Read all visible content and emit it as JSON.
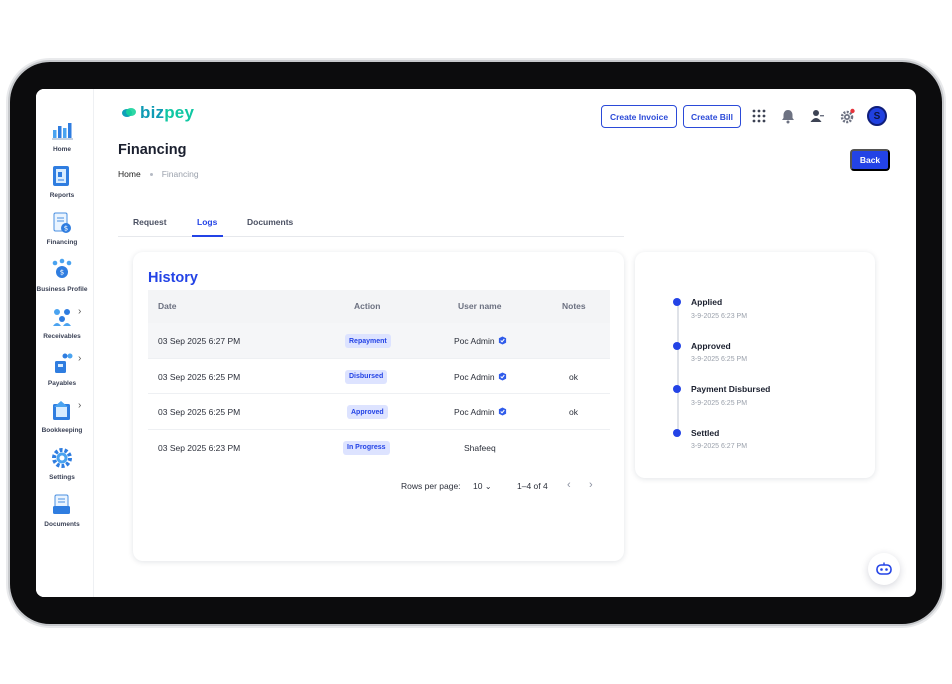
{
  "brand": {
    "name_part1": "biz",
    "name_part2": "pey"
  },
  "sidebar": {
    "items": [
      {
        "label": "Home",
        "icon": "home-chart-icon"
      },
      {
        "label": "Reports",
        "icon": "reports-icon"
      },
      {
        "label": "Financing",
        "icon": "financing-icon"
      },
      {
        "label": "Business Profile",
        "icon": "business-profile-icon"
      },
      {
        "label": "Receivables",
        "icon": "receivables-icon",
        "has_submenu": true
      },
      {
        "label": "Payables",
        "icon": "payables-icon",
        "has_submenu": true
      },
      {
        "label": "Bookkeeping",
        "icon": "bookkeeping-icon",
        "has_submenu": true
      },
      {
        "label": "Settings",
        "icon": "gear-icon"
      },
      {
        "label": "Documents",
        "icon": "documents-icon"
      }
    ]
  },
  "header": {
    "create_invoice_label": "Create Invoice",
    "create_bill_label": "Create Bill",
    "avatar_initial": "S",
    "notification_dot_color": "#e5333b"
  },
  "page": {
    "title": "Financing",
    "breadcrumb": {
      "home": "Home",
      "current": "Financing"
    },
    "back_label": "Back"
  },
  "tabs": [
    {
      "label": "Request",
      "active": false
    },
    {
      "label": "Logs",
      "active": true
    },
    {
      "label": "Documents",
      "active": false
    }
  ],
  "history": {
    "title": "History",
    "columns": [
      "Date",
      "Action",
      "User name",
      "Notes"
    ],
    "rows": [
      {
        "date": "03 Sep 2025 6:27 PM",
        "action": "Repayment",
        "user": "Poc Admin",
        "verified": true,
        "notes": ""
      },
      {
        "date": "03 Sep 2025 6:25 PM",
        "action": "Disbursed",
        "user": "Poc Admin",
        "verified": true,
        "notes": "ok"
      },
      {
        "date": "03 Sep 2025 6:25 PM",
        "action": "Approved",
        "user": "Poc Admin",
        "verified": true,
        "notes": "ok"
      },
      {
        "date": "03 Sep 2025 6:23 PM",
        "action": "In Progress",
        "user": "Shafeeq",
        "verified": false,
        "notes": ""
      }
    ],
    "pagination": {
      "rows_per_page_label": "Rows per page:",
      "rows_per_page_value": "10",
      "range": "1–4 of 4"
    }
  },
  "timeline": [
    {
      "title": "Applied",
      "time": "3-9-2025 6:23 PM"
    },
    {
      "title": "Approved",
      "time": "3-9-2025 6:25 PM"
    },
    {
      "title": "Payment Disbursed",
      "time": "3-9-2025 6:25 PM"
    },
    {
      "title": "Settled",
      "time": "3-9-2025 6:27 PM"
    }
  ],
  "colors": {
    "accent": "#2343e6",
    "brand_teal": "#10c7a3",
    "pill_bg": "#dde3ff"
  }
}
